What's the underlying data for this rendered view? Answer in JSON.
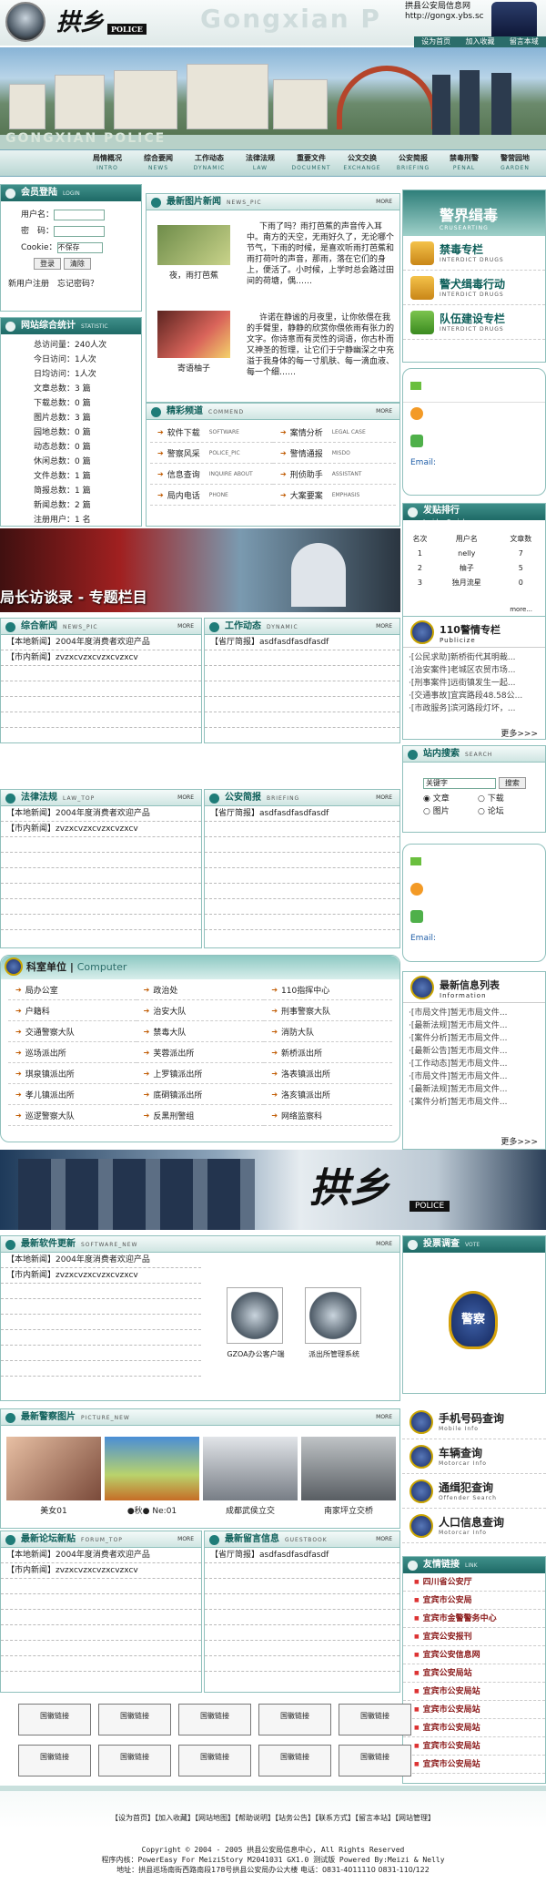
{
  "header": {
    "brand": "拱乡",
    "brand_sub": "POLICE",
    "watermark": "Gongxian P",
    "site_name": "拱县公安局信息网",
    "site_url": "http://gongx.ybs.sc",
    "links": [
      "设为首页",
      "加入收藏",
      "留言本域"
    ]
  },
  "banner": {
    "watermark": "GONGXIAN POLICE"
  },
  "nav": [
    {
      "cn": "局情概况",
      "en": "INTRO"
    },
    {
      "cn": "综合要闻",
      "en": "NEWS"
    },
    {
      "cn": "工作动态",
      "en": "DYNAMIC"
    },
    {
      "cn": "法律法规",
      "en": "LAW"
    },
    {
      "cn": "重要文件",
      "en": "DOCUMENT"
    },
    {
      "cn": "公文交换",
      "en": "EXCHANGE"
    },
    {
      "cn": "公安简报",
      "en": "BRIEFING"
    },
    {
      "cn": "禁毒刑警",
      "en": "PENAL"
    },
    {
      "cn": "警营园地",
      "en": "GARDEN"
    }
  ],
  "login": {
    "title": "会员登陆",
    "en": "LOGIN",
    "user": "用户名：",
    "pass": "密　码：",
    "cookie": "Cookie：",
    "cookie_val": "不保存",
    "btn_login": "登录",
    "btn_clear": "清除",
    "register": "新用户注册",
    "forgot": "忘记密码？"
  },
  "stats": {
    "title": "网站综合统计",
    "en": "STATISTIC",
    "rows": [
      "总访问量：240人次",
      "今日访问：1人次",
      "日均访问：1人次",
      "文章总数：3 篇",
      "下载总数：0 篇",
      "图片总数：3 篇",
      "园地总数：0 篇",
      "动态总数：0 篇",
      "休闲总数：0 篇",
      "文件总数：1 篇",
      "简报总数：1 篇",
      "新闻总数：2 篇",
      "注册用户：1 名"
    ]
  },
  "photo_news": {
    "title": "最新图片新闻",
    "en": "NEWS_PIC",
    "more": "MORE",
    "items": [
      {
        "caption": "夜，雨打芭蕉",
        "text": "下雨了吗？雨打芭蕉的声音传入耳中。南方的天空，无雨好久了，无论哪个节气，下雨的时候，是喜欢听雨打芭蕉和雨打荷叶的声音，那雨，落在它们的身上，便活了。小时候，上学时总会路过田间的荷塘，偶……"
      },
      {
        "caption": "寄语柚子",
        "text": "许诺在静谧的月夜里，让你依偎在我的手臂里，静静的欣赏你偎依雨有张力的文字。你诗意而有灵性的词语，你古朴而又神圣的哲理，让它们于宁静幽深之中充溢于我身体的每一寸肌肤、每一滴血液、每一个细……"
      }
    ]
  },
  "featured": {
    "title": "精彩频道",
    "en": "COMMEND",
    "more": "MORE",
    "items": [
      {
        "cn": "软件下载",
        "en": "SOFTWARE"
      },
      {
        "cn": "案情分析",
        "en": "LEGAL CASE"
      },
      {
        "cn": "警察风采",
        "en": "POLICE_PIC"
      },
      {
        "cn": "警情通报",
        "en": "MISDO"
      },
      {
        "cn": "信息查询",
        "en": "INQUIRE ABOUT"
      },
      {
        "cn": "刑侦助手",
        "en": "ASSISTANT"
      },
      {
        "cn": "局内电话",
        "en": "PHONE"
      },
      {
        "cn": "大案要案",
        "en": "EMPHASIS"
      }
    ]
  },
  "police_box": {
    "title": "警界缉毒",
    "en": "CRUSEARTING",
    "items": [
      {
        "cn": "禁毒专栏",
        "en": "INTERDICT DRUGS"
      },
      {
        "cn": "警犬缉毒行动",
        "en": "INTERDICT DRUGS"
      },
      {
        "cn": "队伍建设专栏",
        "en": "INTERDICT DRUGS"
      }
    ]
  },
  "contact": {
    "email": "Email:"
  },
  "rank": {
    "title": "发贴排行",
    "en": "Insider Serial",
    "cols": [
      "名次",
      "用户名",
      "文章数"
    ],
    "rows": [
      [
        "1",
        "nelly",
        "7"
      ],
      [
        "2",
        "柚子",
        "5"
      ],
      [
        "3",
        "独月流星",
        "0"
      ]
    ],
    "more": "more..."
  },
  "special": {
    "title": "局长访谈录 - 专题栏目"
  },
  "news": {
    "title": "综合新闻",
    "en": "NEWS_PIC",
    "more": "MORE",
    "items": [
      "【本地新闻】2004年度消费者欢迎产品",
      "【市内新闻】zvzxcvzxcvzxcvzxcv"
    ]
  },
  "work": {
    "title": "工作动态",
    "en": "DYNAMIC",
    "more": "MORE",
    "items": [
      "【省厅简报】asdfasdfasdfasdf"
    ]
  },
  "law": {
    "title": "法律法规",
    "en": "LAW_TOP",
    "more": "MORE",
    "items": [
      "【本地新闻】2004年度消费者欢迎产品",
      "【市内新闻】zvzxcvzxcvzxcvzxcv"
    ]
  },
  "brief": {
    "title": "公安简报",
    "en": "BRIEFING",
    "more": "MORE",
    "items": [
      "【省厅简报】asdfasdfasdfasdf"
    ]
  },
  "col110": {
    "title": "110警情专栏",
    "en": "Publicize",
    "items": [
      "·[公民求助]新桥街代其明裁...",
      "·[治安案件]老城区农贸市场...",
      "·[刑事案件]远街镇发生一起...",
      "·[交通事故]宜宾路段48.58公...",
      "·[市政服务]滨河路段灯坏，..."
    ],
    "more": "更多>>>"
  },
  "search": {
    "title": "站内搜索",
    "en": "SEARCH",
    "placeholder": "关键字",
    "btn": "搜索",
    "opts": [
      "文章",
      "下载",
      "图片",
      "论坛"
    ]
  },
  "units": {
    "title": "科室单位",
    "en": "Computer",
    "items": [
      "局办公室",
      "政治处",
      "110指挥中心",
      "户籍科",
      "治安大队",
      "刑事警察大队",
      "交通警察大队",
      "禁毒大队",
      "消防大队",
      "巡场派出所",
      "芙蓉派出所",
      "新桥派出所",
      "琪泉镇派出所",
      "上罗镇派出所",
      "洛表镇派出所",
      "孝儿镇派出所",
      "底硐镇派出所",
      "洛亥镇派出所",
      "巡逻警察大队",
      "反黑刑警组",
      "网络监察科"
    ]
  },
  "latest_info": {
    "title": "最新信息列表",
    "en": "Information",
    "items": [
      "·[市局文件]暂无市局文件...",
      "·[最新法规]暂无市局文件...",
      "·[案件分析]暂无市局文件...",
      "·[最新公告]暂无市局文件...",
      "·[工作动态]暂无市局文件...",
      "·[市局文件]暂无市局文件...",
      "·[最新法规]暂无市局文件...",
      "·[案件分析]暂无市局文件..."
    ],
    "more": "更多>>>"
  },
  "software": {
    "title": "最新软件更新",
    "en": "SOFTWARE_NEW",
    "more": "MORE",
    "items": [
      "【本地新闻】2004年度消费者欢迎产品",
      "【市内新闻】zvzxcvzxcvzxcvzxcv"
    ],
    "apps": [
      "GZOA办公客户端",
      "派出所管理系统"
    ]
  },
  "vote": {
    "title": "投票调查",
    "en": "VOTE",
    "emblem": "警察"
  },
  "pics": {
    "title": "最新警察图片",
    "en": "PICTURE_NEW",
    "more": "MORE",
    "items": [
      "美女01",
      "●秋● Ne:01",
      "成都武侯立交",
      "南家坪立交桥"
    ]
  },
  "queries": [
    {
      "cn": "手机号码查询",
      "en": "Mobile Info"
    },
    {
      "cn": "车辆查询",
      "en": "Motorcar Info"
    },
    {
      "cn": "通缉犯查询",
      "en": "Offender Search"
    },
    {
      "cn": "人口信息查询",
      "en": "Motorcar Info"
    }
  ],
  "forum": {
    "title": "最新论坛新贴",
    "en": "FORUM_TOP",
    "more": "MORE",
    "items": [
      "【本地新闻】2004年度消费者欢迎产品",
      "【市内新闻】zvzxcvzxcvzxcvzxcv"
    ]
  },
  "guest": {
    "title": "最新留言信息",
    "en": "GUESTBOOK",
    "more": "MORE",
    "items": [
      "【省厅简报】asdfasdfasdfasdf"
    ]
  },
  "friends": {
    "title": "友情链接",
    "en": "LINK",
    "items": [
      "四川省公安厅",
      "宜宾市公安局",
      "宜宾市金警警务中心",
      "宜宾公安报刊",
      "宜宾公安信息网",
      "宜宾公安局站",
      "宜宾市公安局站",
      "宜宾市公安局站",
      "宜宾市公安局站",
      "宜宾市公安局站",
      "宜宾市公安局站",
      "宜宾市公安局站"
    ]
  },
  "links_btn": "国徽链接",
  "footer": {
    "links": "【设为首页】【加入收藏】【网站地图】【帮助说明】【站务公告】【联系方式】【留言本站】【网站管理】",
    "copy": "Copyright © 2004 - 2005  拱县公安局信息中心, All Rights Reserved",
    "sys": "程序内核：PowerEasy For MeiziStory M2041031 GX1.0 测试版  Powered By:Meizi & Nelly",
    "addr": "地址：拱县巡场南街西路南段178号拱县公安局办公大楼  电话：0831-4011110  0831-110/122"
  }
}
